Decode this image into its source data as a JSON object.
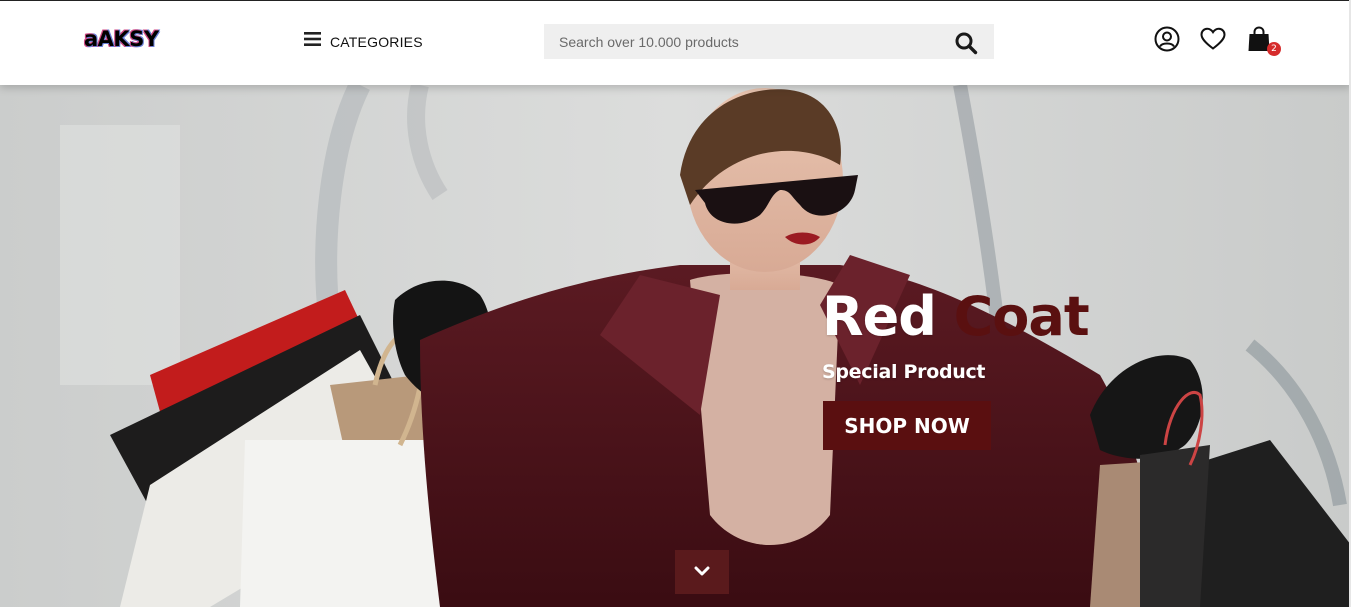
{
  "header": {
    "logo": "aAKSY",
    "categories_label": "CATEGORIES",
    "search_placeholder": "Search over 10.000 products",
    "cart_count": "2"
  },
  "hero": {
    "title_word1": "Red",
    "title_word2": "Coat",
    "subtitle": "Special Product",
    "cta_label": "SHOP NOW"
  },
  "colors": {
    "accent": "#5a0f10",
    "badge": "#d62c2c"
  },
  "icons": [
    "hamburger-icon",
    "search-icon",
    "user-icon",
    "heart-icon",
    "shopping-bag-icon",
    "chevron-down-icon"
  ]
}
